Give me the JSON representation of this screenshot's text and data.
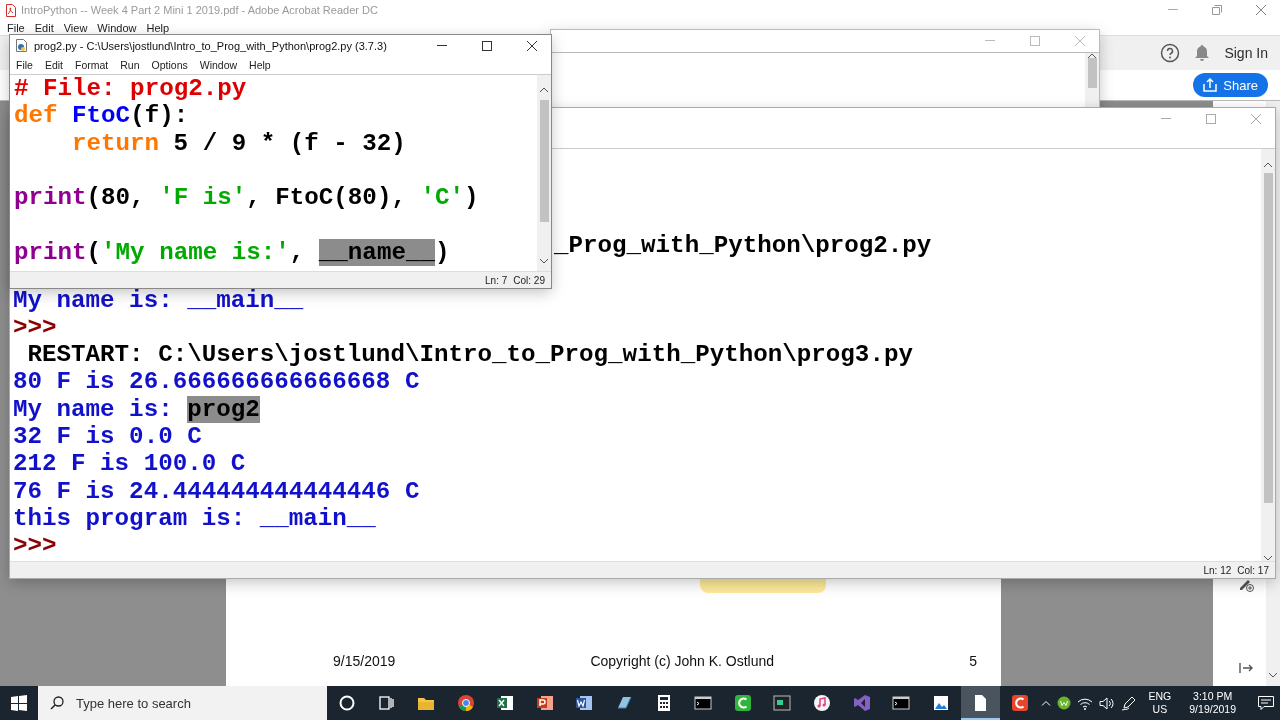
{
  "acrobat": {
    "title": "IntroPython -- Week 4 Part 2 Mini 1 2019.pdf - Adobe Acrobat Reader DC",
    "menu": [
      "File",
      "Edit",
      "View",
      "Window",
      "Help"
    ],
    "sign_in": "Sign In",
    "share": "Share",
    "footer": {
      "date": "9/15/2019",
      "copyright": "Copyright (c) John K. Ostlund",
      "page": "5"
    }
  },
  "shell": {
    "lines": [
      {
        "kind": "clipped",
        "segments": [
          {
            "kind": "restart",
            "text": "_Prog_with_Python\\prog2.py"
          }
        ]
      },
      {
        "kind": "blank"
      },
      {
        "kind": "full",
        "segments": [
          {
            "kind": "stdout",
            "text": "My name is: __main__"
          }
        ]
      },
      {
        "kind": "full",
        "segments": [
          {
            "kind": "prompt",
            "text": ">>>"
          }
        ]
      },
      {
        "kind": "full",
        "segments": [
          {
            "kind": "restart",
            "text": " RESTART: C:\\Users\\jostlund\\Intro_to_Prog_with_Python\\prog3.py"
          }
        ]
      },
      {
        "kind": "full",
        "segments": [
          {
            "kind": "stdout",
            "text": "80 F is 26.666666666666668 C"
          }
        ]
      },
      {
        "kind": "full",
        "segments": [
          {
            "kind": "stdout",
            "text": "My name is: "
          },
          {
            "kind": "highlight",
            "text": "prog2"
          }
        ]
      },
      {
        "kind": "full",
        "segments": [
          {
            "kind": "stdout",
            "text": "32 F is 0.0 C"
          }
        ]
      },
      {
        "kind": "full",
        "segments": [
          {
            "kind": "stdout",
            "text": "212 F is 100.0 C"
          }
        ]
      },
      {
        "kind": "full",
        "segments": [
          {
            "kind": "stdout",
            "text": "76 F is 24.444444444444446 C"
          }
        ]
      },
      {
        "kind": "full",
        "segments": [
          {
            "kind": "stdout",
            "text": "this program is: __main__"
          }
        ]
      },
      {
        "kind": "full",
        "segments": [
          {
            "kind": "prompt",
            "text": ">>>"
          }
        ]
      }
    ],
    "status": {
      "line": "Ln: 12",
      "col": "Col: 17"
    }
  },
  "editor": {
    "title": "prog2.py - C:\\Users\\jostlund\\Intro_to_Prog_with_Python\\prog2.py (3.7.3)",
    "menu": [
      "File",
      "Edit",
      "Format",
      "Run",
      "Options",
      "Window",
      "Help"
    ],
    "lines": [
      {
        "kind": "full",
        "segments": [
          {
            "kind": "comment",
            "text": "# File: prog2.py"
          }
        ]
      },
      {
        "kind": "full",
        "segments": [
          {
            "kind": "keyword",
            "text": "def "
          },
          {
            "kind": "defname",
            "text": "FtoC"
          },
          {
            "kind": "plain",
            "text": "(f):"
          }
        ]
      },
      {
        "kind": "indented",
        "segments": [
          {
            "kind": "keyword",
            "text": "return"
          },
          {
            "kind": "plain",
            "text": " 5 / 9 * (f - 32)"
          }
        ]
      },
      {
        "kind": "blank"
      },
      {
        "kind": "full",
        "segments": [
          {
            "kind": "builtin",
            "text": "print"
          },
          {
            "kind": "plain",
            "text": "(80, "
          },
          {
            "kind": "string",
            "text": "'F is'"
          },
          {
            "kind": "plain",
            "text": ", FtoC(80), "
          },
          {
            "kind": "string",
            "text": "'C'"
          },
          {
            "kind": "plain",
            "text": ")"
          }
        ]
      },
      {
        "kind": "blank"
      },
      {
        "kind": "full",
        "segments": [
          {
            "kind": "builtin",
            "text": "print"
          },
          {
            "kind": "plain",
            "text": "("
          },
          {
            "kind": "string",
            "text": "'My name is:'"
          },
          {
            "kind": "plain",
            "text": ", "
          },
          {
            "kind": "highlight",
            "text": "__name__"
          },
          {
            "kind": "plain",
            "text": ")"
          }
        ]
      }
    ],
    "status": {
      "line": "Ln: 7",
      "col": "Col: 29"
    }
  },
  "taskbar": {
    "search_placeholder": "Type here to search",
    "apps": [
      {
        "kind": "cortana",
        "selected": false
      },
      {
        "kind": "taskview",
        "selected": false
      },
      {
        "kind": "folder",
        "selected": false
      },
      {
        "kind": "browser",
        "selected": false
      },
      {
        "kind": "sheet",
        "selected": false
      },
      {
        "kind": "slides",
        "selected": false
      },
      {
        "kind": "writer",
        "selected": false
      },
      {
        "kind": "notes",
        "selected": false
      },
      {
        "kind": "calculator",
        "selected": false
      },
      {
        "kind": "terminal",
        "selected": false
      },
      {
        "kind": "recorder",
        "selected": false
      },
      {
        "kind": "console",
        "selected": false
      },
      {
        "kind": "music",
        "selected": false
      },
      {
        "kind": "ide",
        "selected": false
      },
      {
        "kind": "terminal",
        "selected": false
      },
      {
        "kind": "photo",
        "selected": false
      },
      {
        "kind": "page",
        "selected": true
      },
      {
        "kind": "capture",
        "selected": false
      }
    ],
    "language": "ENG",
    "region": "US",
    "time": "3:10 PM",
    "date": "9/19/2019"
  }
}
